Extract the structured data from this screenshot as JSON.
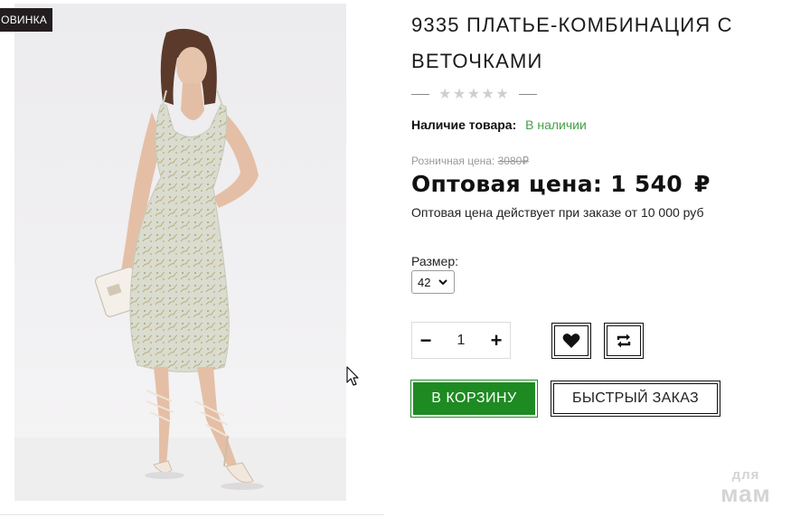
{
  "badge": {
    "label": "ОВИНКА"
  },
  "product": {
    "title": "9335 ПЛАТЬЕ-КОМБИНАЦИЯ С ВЕТОЧКАМИ",
    "rating": {
      "stars": 5,
      "filled": 0,
      "glyphs": "★★★★★"
    },
    "availability": {
      "label": "Наличие товара:",
      "value": "В наличии"
    },
    "retail_price": {
      "label": "Розничная цена:",
      "value": "3080₽"
    },
    "wholesale_price": {
      "label": "Оптовая цена:",
      "value": "1 540",
      "currency": "₽"
    },
    "wholesale_note": "Оптовая цена действует при заказе от 10 000 руб",
    "size": {
      "label": "Размер:",
      "selected": "42"
    },
    "quantity": {
      "minus": "−",
      "value": "1",
      "plus": "+"
    }
  },
  "actions": {
    "wishlist_icon": "heart-icon",
    "compare_icon": "compare-arrows-icon",
    "add_to_cart": "В КОРЗИНУ",
    "quick_order": "БЫСТРЫЙ ЗАКАЗ"
  },
  "watermark": {
    "line1": "для",
    "line2": "мам"
  },
  "colors": {
    "cart_button": "#1e8a22",
    "in_stock": "#43a047",
    "badge": "#231d20"
  }
}
